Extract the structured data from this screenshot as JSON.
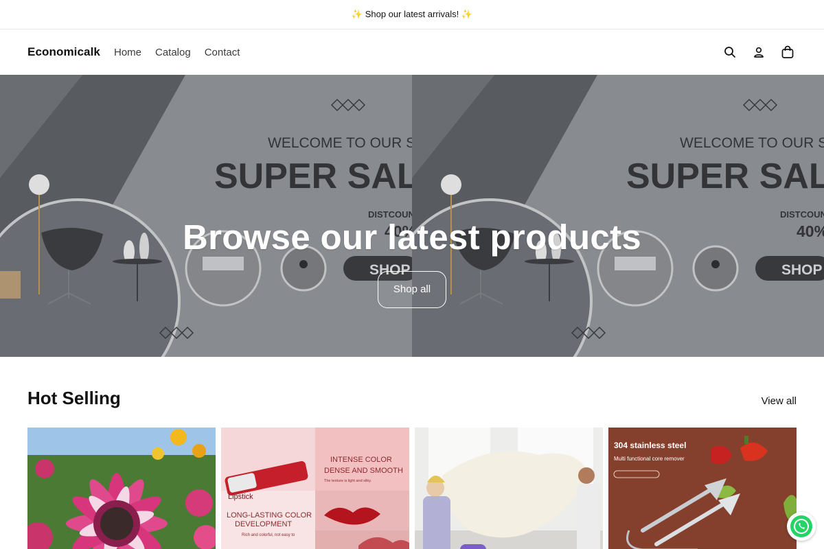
{
  "announcement": {
    "text": "✨ Shop our latest arrivals! ✨"
  },
  "header": {
    "logo": "Economicalk",
    "nav": [
      {
        "label": "Home"
      },
      {
        "label": "Catalog"
      },
      {
        "label": "Contact"
      }
    ],
    "icons": [
      "search-icon",
      "account-icon",
      "cart-icon"
    ]
  },
  "hero": {
    "title": "Browse our latest products",
    "button": "Shop all",
    "banner": {
      "welcome": "WELCOME TO OUR ST",
      "sale": "SUPER SAL",
      "discount_label": "DISTCOUN",
      "discount_value": "40%",
      "shop": "SHOP N"
    }
  },
  "section": {
    "title": "Hot Selling",
    "view_all": "View all"
  },
  "products": [
    {
      "name": "sunflower"
    },
    {
      "name": "lipstick",
      "texts": {
        "top_right": "INTENSE COLOR DENSE AND SMOOTH",
        "top_right_sub": "The texture is light and silky. Soft and easy to push open, good ductility",
        "bottom_left": "LONG-LASTING COLOR DEVELOPMENT",
        "bottom_left_sub": "Rich and colorful, not easy to fade, added non-stick cup formula",
        "brand": "Lipstick"
      }
    },
    {
      "name": "bedding"
    },
    {
      "name": "core-remover",
      "texts": {
        "title": "304 stainless steel",
        "subtitle": "Multi functional core remover"
      }
    }
  ],
  "colors": {
    "banner_bg": "#8e9196",
    "banner_text": "#35373b",
    "hero_text": "#ffffff",
    "whatsapp": "#25d366"
  }
}
